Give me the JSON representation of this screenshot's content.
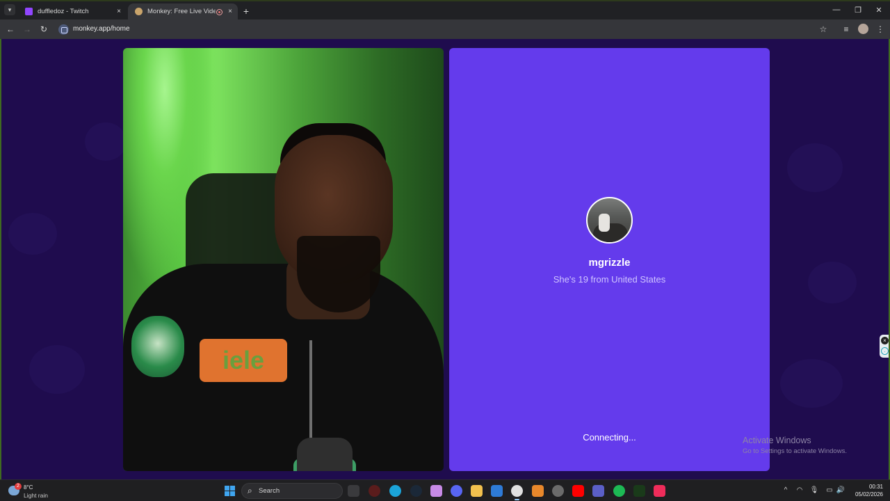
{
  "browser": {
    "tabs": [
      {
        "title": "duffledoz - Twitch",
        "active": false
      },
      {
        "title": "Monkey: Free Live Video Ch",
        "active": true
      }
    ],
    "url": "monkey.app/home",
    "icons": {
      "menu": "chevron-down-icon",
      "close": "×",
      "new_tab": "+",
      "back": "←",
      "forward": "→",
      "reload": "↻",
      "star": "☆",
      "list": "≡",
      "more": "⋮",
      "minimize": "—",
      "restore": "❐",
      "win_close": "✕"
    }
  },
  "call": {
    "peer": {
      "name": "mgrizzle",
      "info": "She's 19 from United States"
    },
    "status": "Connecting...",
    "colors": {
      "peer_panel": "#643bec",
      "background": "#1f0c4e"
    }
  },
  "self_video": {
    "patch_text": "ɘlɘi"
  },
  "watermark": {
    "line1": "Activate Windows",
    "line2": "Go to Settings to activate Windows."
  },
  "taskbar": {
    "weather": {
      "alert_count": "2",
      "temp": "8°C",
      "condition": "Light rain"
    },
    "search_placeholder": "Search",
    "search_icon": "⌕",
    "tray": {
      "up": "^",
      "wifi": "◠",
      "mic": "🎙",
      "volume": "🔊"
    },
    "time": "00:31",
    "date": "05/02/2026"
  }
}
